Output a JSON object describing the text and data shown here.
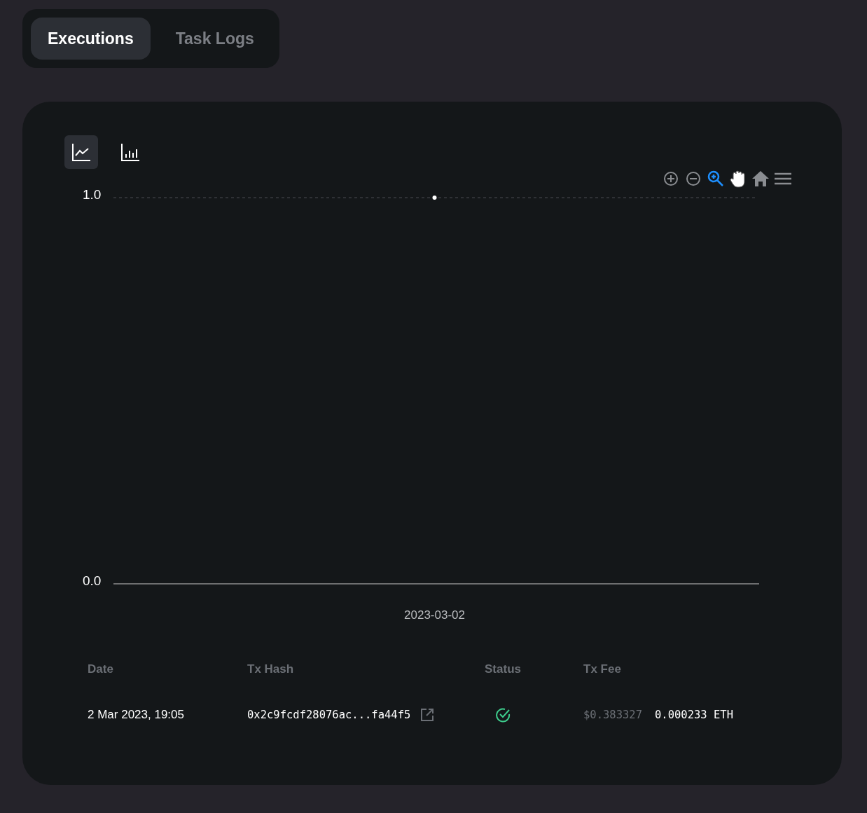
{
  "tabs": [
    {
      "label": "Executions",
      "selected": true
    },
    {
      "label": "Task Logs",
      "selected": false
    }
  ],
  "chart_toggles": [
    {
      "kind": "line",
      "selected": true
    },
    {
      "kind": "bar",
      "selected": false
    }
  ],
  "chart_tools": [
    {
      "kind": "zoom-in",
      "selected": false
    },
    {
      "kind": "zoom-out",
      "selected": false
    },
    {
      "kind": "zoom",
      "selected": true
    },
    {
      "kind": "pan",
      "selected": false
    },
    {
      "kind": "reset",
      "selected": false
    },
    {
      "kind": "menu",
      "selected": false
    }
  ],
  "chart_data": {
    "type": "line",
    "categories": [
      "2023-03-02"
    ],
    "series": [
      {
        "color": "#ffffff",
        "marker": "circle",
        "values": [
          1
        ]
      }
    ],
    "ylim": [
      0,
      1
    ],
    "yticks": [
      {
        "value": 0,
        "label": "0.0"
      },
      {
        "value": 1,
        "label": "1.0"
      }
    ]
  },
  "table": {
    "columns": [
      "Date",
      "Tx Hash",
      "Status",
      "Tx Fee"
    ],
    "rows": [
      {
        "date": "2 Mar 2023, 19:05",
        "tx_hash": "0x2c9fcdf28076ac...fa44f5",
        "succeeded": true,
        "fee_usd": "$0.383327",
        "fee_eth": "0.000233 ETH"
      }
    ]
  }
}
